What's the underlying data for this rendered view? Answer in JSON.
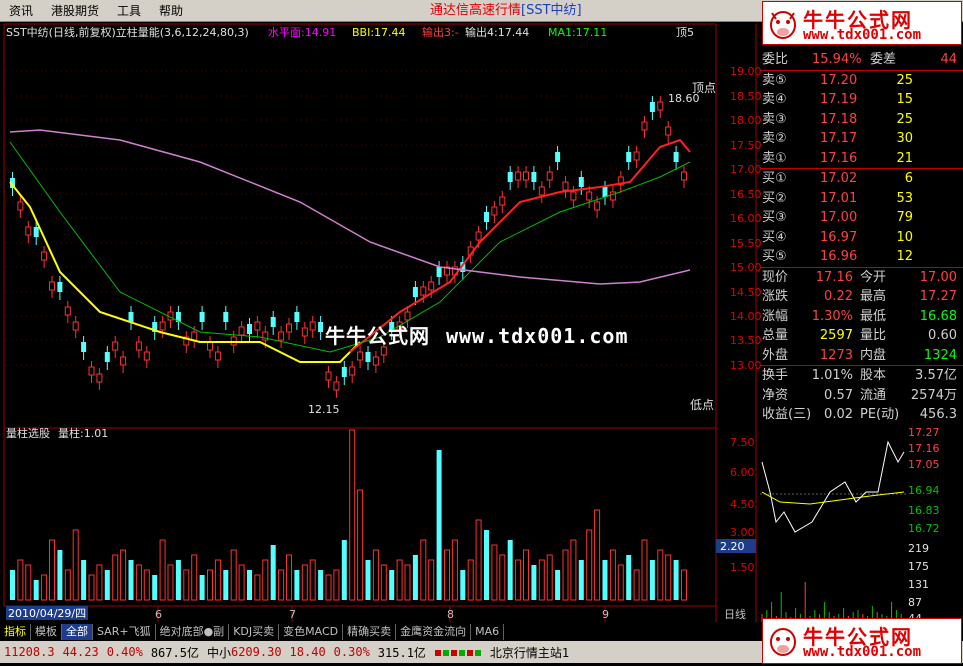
{
  "menu": [
    "资讯",
    "港股期货",
    "工具",
    "帮助"
  ],
  "title": {
    "text": "通达信高速行情",
    "code": "[SST中纺]"
  },
  "logo": {
    "cn": "牛牛公式网",
    "url": "www.tdx001.com"
  },
  "indicator_header": [
    "SST中纺(日线,前复权)立柱量能(3,6,12,24,80,3)",
    "水平面:14.91",
    "BBI:17.44",
    "输出3:-",
    "输出4:17.44",
    "MA1:17.11"
  ],
  "right_axis_top": [
    "19.00",
    "18.50",
    "18.00",
    "17.50",
    "17.00",
    "16.50",
    "16.00",
    "15.50",
    "15.00",
    "14.50",
    "14.00",
    "13.50",
    "13.00"
  ],
  "right_axis_bottom": [
    "7.50",
    "6.00",
    "4.50",
    "3.00",
    "2.20",
    "1.50"
  ],
  "chart_labels": {
    "top": "顶点",
    "bottom": "低点",
    "high_mark": "18.60",
    "low_mark": "12.15",
    "vol_title": "量柱选股",
    "vol_val": "量柱:1.01",
    "date": "2010/04/29/四",
    "months": [
      "6",
      "7",
      "8",
      "9"
    ],
    "period": "日线"
  },
  "quote": {
    "weibi": {
      "label": "委比",
      "value": "15.94%",
      "diff_label": "委差",
      "diff": "44"
    },
    "sells": [
      {
        "l": "卖⑤",
        "p": "17.20",
        "v": "25"
      },
      {
        "l": "卖④",
        "p": "17.19",
        "v": "15"
      },
      {
        "l": "卖③",
        "p": "17.18",
        "v": "25"
      },
      {
        "l": "卖②",
        "p": "17.17",
        "v": "30"
      },
      {
        "l": "卖①",
        "p": "17.16",
        "v": "21"
      }
    ],
    "buys": [
      {
        "l": "买①",
        "p": "17.02",
        "v": "6"
      },
      {
        "l": "买②",
        "p": "17.01",
        "v": "53"
      },
      {
        "l": "买③",
        "p": "17.00",
        "v": "79"
      },
      {
        "l": "买④",
        "p": "16.97",
        "v": "10"
      },
      {
        "l": "买⑤",
        "p": "16.96",
        "v": "12"
      }
    ],
    "stats": [
      {
        "l1": "现价",
        "v1": "17.16",
        "l2": "今开",
        "v2": "17.00"
      },
      {
        "l1": "涨跌",
        "v1": "0.22",
        "l2": "最高",
        "v2": "17.27"
      },
      {
        "l1": "涨幅",
        "v1": "1.30%",
        "l2": "最低",
        "v2": "16.68"
      },
      {
        "l1": "总量",
        "v1": "2597",
        "l2": "量比",
        "v2": "0.60"
      },
      {
        "l1": "外盘",
        "v1": "1273",
        "l2": "内盘",
        "v2": "1324"
      },
      {
        "l1": "换手",
        "v1": "1.01%",
        "l2": "股本",
        "v2": "3.57亿"
      },
      {
        "l1": "净资",
        "v1": "0.57",
        "l2": "流通",
        "v2": "2574万"
      },
      {
        "l1": "收益(三)",
        "v1": "0.02",
        "l2": "PE(动)",
        "v2": "456.3"
      }
    ]
  },
  "mini_axis": [
    "17.27",
    "17.16",
    "17.05",
    "16.94",
    "16.83",
    "16.72",
    "219",
    "175",
    "131",
    "87",
    "44"
  ],
  "tabs": [
    "指标",
    "模板",
    "全部",
    "SAR+飞狐",
    "绝对底部●副",
    "KDJ买卖",
    "变色MACD",
    "精确买卖",
    "金鹰资金流向",
    "MA6"
  ],
  "status": {
    "idx1": "11208.3",
    "chg1": "44.23",
    "pct1": "0.40%",
    "amt1": "867.5亿",
    "name2": "中小",
    "idx2": "6209.30",
    "chg2": "18.40",
    "pct2": "0.30%",
    "amt2": "315.1亿",
    "server": "北京行情主站1"
  }
}
